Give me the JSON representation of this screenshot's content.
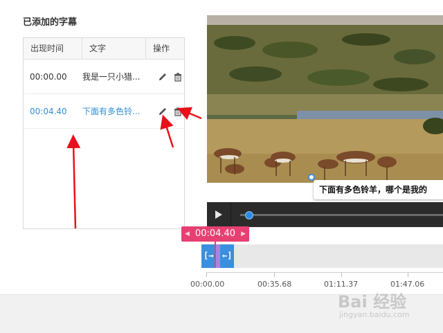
{
  "panel": {
    "title": "已添加的字幕",
    "columns": [
      "出现时间",
      "文字",
      "操作"
    ],
    "rows": [
      {
        "time": "00:00.00",
        "text": "我是一只小猎..."
      },
      {
        "time": "00:04.40",
        "text": "下面有多色铃..."
      }
    ]
  },
  "video": {
    "caption": "下面有多色铃羊，哪个是我的",
    "progress": 0.05
  },
  "timeline": {
    "current_time": "00:04.40",
    "ticks": [
      "00:00.00",
      "00:35.68",
      "01:11.37",
      "01:47.06"
    ],
    "clip_start_handle": "[→",
    "clip_end_handle": "←]"
  },
  "watermark": {
    "text": "Bai 经验",
    "sub": "jingyan.baidu.com"
  },
  "colors": {
    "accent": "#2f8fd8",
    "flag": "#e64072",
    "clip": "#3b8fdf",
    "annotation_arrow": "#e8101a"
  }
}
